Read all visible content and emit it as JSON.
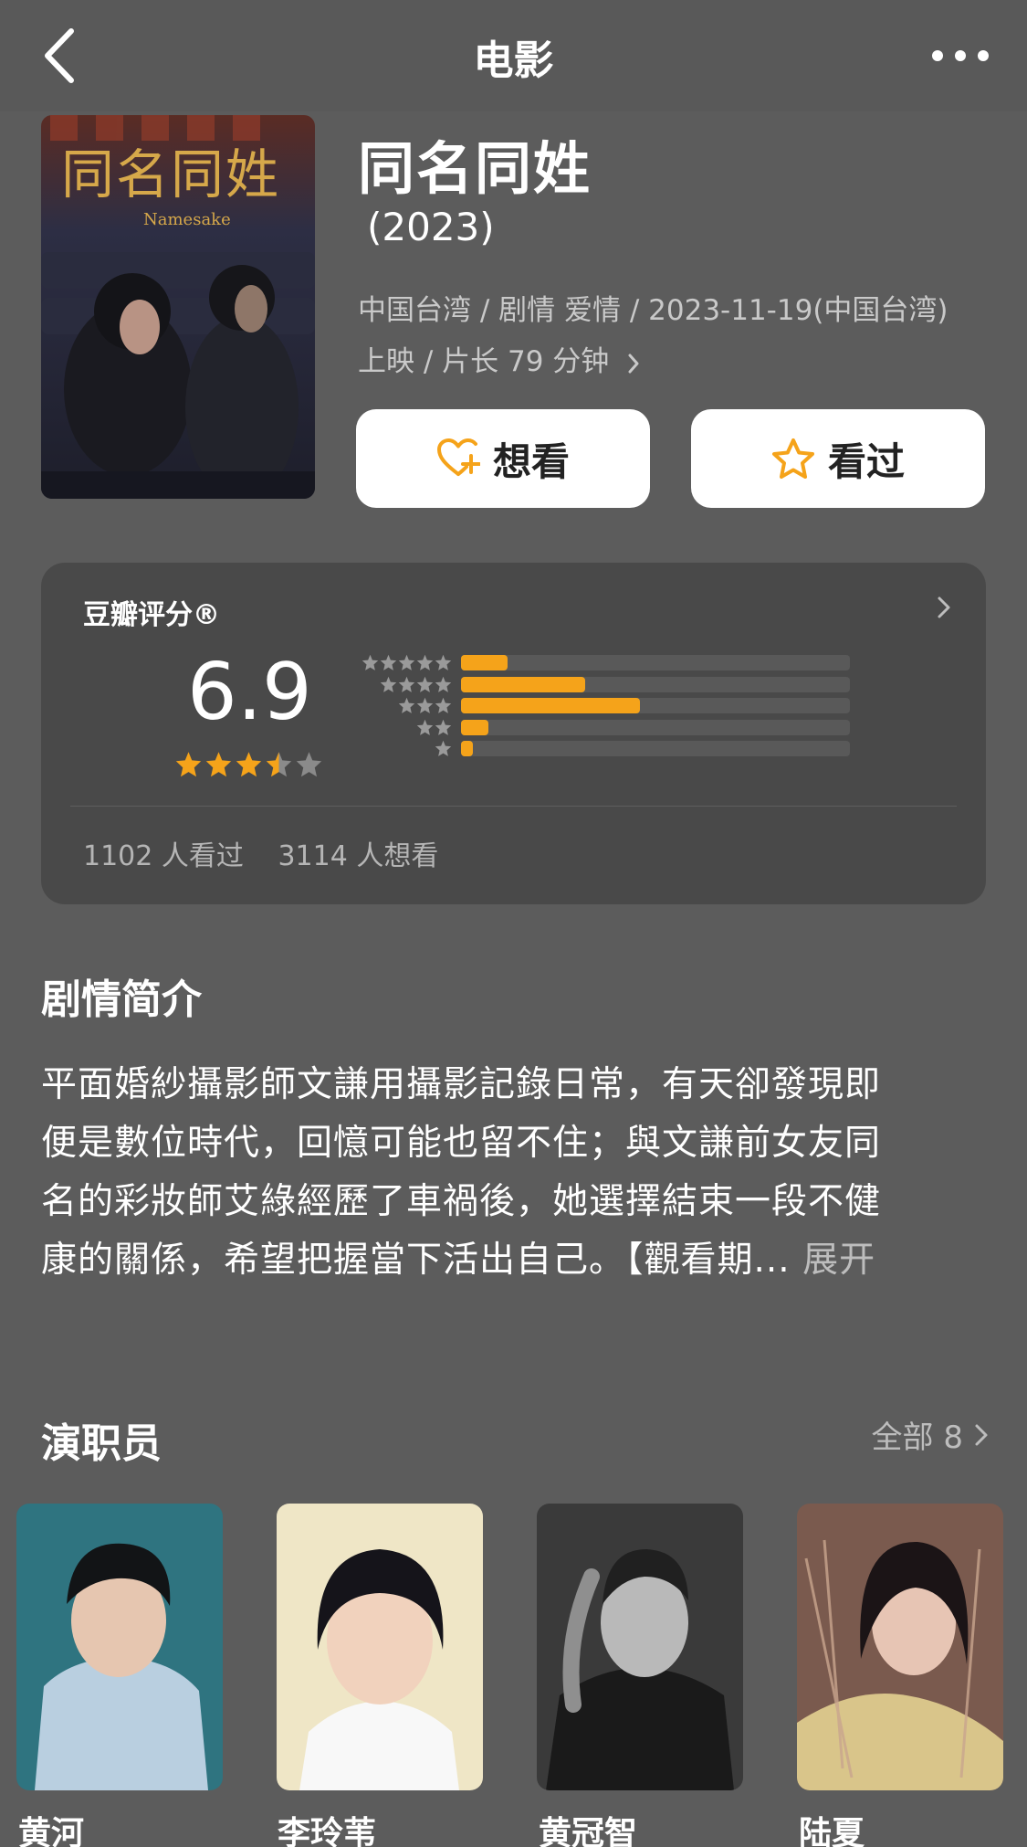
{
  "nav": {
    "title": "电影",
    "back_icon": "back-chevron-icon",
    "more_icon": "more-dots-icon"
  },
  "movie": {
    "title": "同名同姓",
    "year": "(2023)",
    "meta_line1": "中国台湾 / 剧情 爱情 / 2023-11-19(中国台湾)",
    "meta_line2": "上映 / 片长 79 分钟",
    "poster_text_main": "同名同姓",
    "poster_text_sub": "Namesake"
  },
  "actions": {
    "want_label": "想看",
    "seen_label": "看过"
  },
  "rating": {
    "source": "豆瓣评分®",
    "score": "6.9",
    "stars": 3.5,
    "distribution": [
      {
        "stars": 5,
        "fraction": 0.12
      },
      {
        "stars": 4,
        "fraction": 0.32
      },
      {
        "stars": 3,
        "fraction": 0.46
      },
      {
        "stars": 2,
        "fraction": 0.07
      },
      {
        "stars": 1,
        "fraction": 0.03
      }
    ],
    "seen_count": "1102 人看过",
    "want_count": "3114 人想看"
  },
  "synopsis": {
    "heading": "剧情简介",
    "lines": [
      "平面婚紗攝影師文謙用攝影記錄日常，有天卻發現即",
      "便是數位時代，回憶可能也留不住；與文謙前女友同",
      "名的彩妝師艾綠經歷了車禍後，她選擇結束一段不健",
      "康的關係，希望把握當下活出自己。【觀看期..."
    ],
    "expand_label": "展开"
  },
  "cast": {
    "heading": "演职员",
    "all_label": "全部 8",
    "members": [
      {
        "name": "黄河"
      },
      {
        "name": "李玲苇"
      },
      {
        "name": "黄冠智"
      },
      {
        "name": "陆夏"
      }
    ]
  },
  "colors": {
    "accent": "#f5a31a",
    "background": "#5c5c5c",
    "card": "#494949"
  }
}
